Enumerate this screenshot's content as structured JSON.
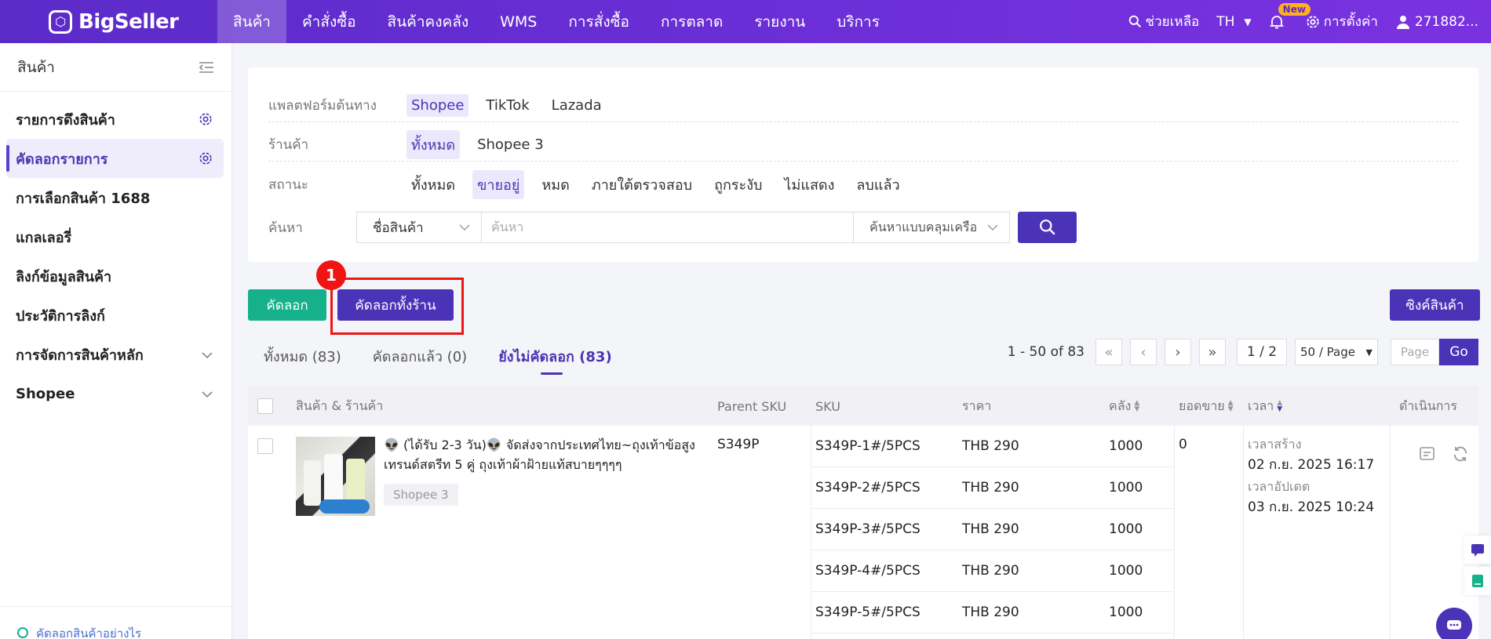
{
  "brand": {
    "name": "BigSeller"
  },
  "nav": {
    "items": [
      {
        "label": "สินค้า",
        "active": true
      },
      {
        "label": "คำสั่งซื้อ"
      },
      {
        "label": "สินค้าคงคลัง"
      },
      {
        "label": "WMS"
      },
      {
        "label": "การสั่งซื้อ"
      },
      {
        "label": "การตลาด"
      },
      {
        "label": "รายงาน"
      },
      {
        "label": "บริการ"
      }
    ],
    "help": "ช่วยเหลือ",
    "lang": "TH",
    "new_badge": "New",
    "settings": "การตั้งค่า",
    "user": "271882..."
  },
  "sidebar": {
    "title": "สินค้า",
    "items": [
      {
        "label": "รายการดึงสินค้า"
      },
      {
        "label": "คัดลอกรายการ",
        "active": true
      },
      {
        "label": "การเลือกสินค้า 1688"
      },
      {
        "label": "แกลเลอรี่"
      },
      {
        "label": "ลิงก์ข้อมูลสินค้า"
      },
      {
        "label": "ประวัติการลิงก์"
      },
      {
        "label": "การจัดการสินค้าหลัก"
      },
      {
        "label": "Shopee"
      }
    ],
    "footer": "คัดลอกสินค้าอย่างไร"
  },
  "filter": {
    "platform": {
      "label": "แพลตฟอร์มต้นทาง",
      "options": [
        "Shopee",
        "TikTok",
        "Lazada"
      ],
      "selected": "Shopee"
    },
    "store": {
      "label": "ร้านค้า",
      "options": [
        "ทั้งหมด",
        "Shopee 3"
      ],
      "selected": "ทั้งหมด"
    },
    "status": {
      "label": "สถานะ",
      "options": [
        "ทั้งหมด",
        "ขายอยู่",
        "หมด",
        "ภายใต้ตรวจสอบ",
        "ถูกระงับ",
        "ไม่แสดง",
        "ลบแล้ว"
      ],
      "selected": "ขายอยู่"
    },
    "search": {
      "label": "ค้นหา",
      "field": "ชื่อสินค้า",
      "placeholder": "ค้นหา",
      "mode": "ค้นหาแบบคลุมเครือ"
    }
  },
  "actions": {
    "copy": "คัดลอก",
    "copy_all": "คัดลอกทั้งร้าน",
    "step_badge": "1",
    "sync": "ซิงค์สินค้า"
  },
  "tabs": [
    {
      "label": "ทั้งหมด (83)"
    },
    {
      "label": "คัดลอกแล้ว (0)"
    },
    {
      "label": "ยังไม่คัดลอก (83)",
      "active": true
    }
  ],
  "pagination": {
    "range": "1 - 50 of 83",
    "current": "1 / 2",
    "page_size": "50 / Page",
    "page_placeholder": "Page",
    "go": "Go"
  },
  "table": {
    "columns": {
      "product": "สินค้า & ร้านค้า",
      "parent_sku": "Parent SKU",
      "sku": "SKU",
      "price": "ราคา",
      "stock": "คลัง",
      "sales": "ยอดขาย",
      "time": "เวลา",
      "action": "ดำเนินการ"
    },
    "row": {
      "title": "👽 (ได้รับ 2-3 วัน)👽 จัดส่งจากประเทศไทย~ถุงเท้าข้อสูงเทรนด์สตรีท 5 คู่ ถุงเท้าผ้าฝ้ายแท้สบายๆๆๆๆ",
      "store": "Shopee 3",
      "parent_sku": "S349P",
      "sales": "0",
      "created_label": "เวลาสร้าง",
      "created": "02 ก.ย. 2025 16:17",
      "updated_label": "เวลาอัปเดต",
      "updated": "03 ก.ย. 2025 10:24",
      "variants": [
        {
          "sku": "S349P-1#/5PCS",
          "price": "THB 290",
          "stock": "1000"
        },
        {
          "sku": "S349P-2#/5PCS",
          "price": "THB 290",
          "stock": "1000"
        },
        {
          "sku": "S349P-3#/5PCS",
          "price": "THB 290",
          "stock": "1000"
        },
        {
          "sku": "S349P-4#/5PCS",
          "price": "THB 290",
          "stock": "1000"
        },
        {
          "sku": "S349P-5#/5PCS",
          "price": "THB 290",
          "stock": "1000"
        }
      ]
    }
  },
  "icons": {
    "logo": "bigseller-logo-icon",
    "search": "search-icon",
    "bell": "bell-icon",
    "gear": "gear-icon",
    "user": "user-icon",
    "collapse": "collapse-menu-icon",
    "chat": "chat-icon"
  },
  "colors": {
    "primary": "#4b33b8",
    "success": "#16b08a",
    "highlight": "#f01414"
  }
}
